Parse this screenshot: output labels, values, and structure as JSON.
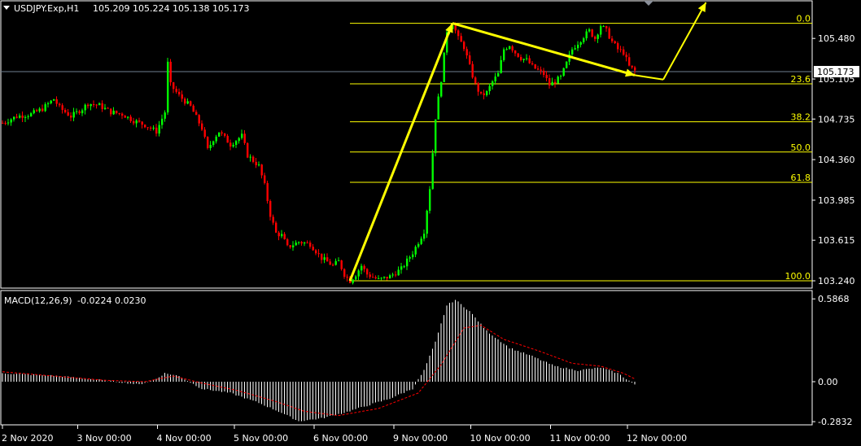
{
  "header": {
    "symbol": "USDJPY.Exp,H1",
    "ohlc": "105.209 105.224 105.138 105.173",
    "menu_icon": "triangle-down-icon"
  },
  "colors": {
    "background": "#000000",
    "bull": "#00ff00",
    "bear": "#ff0000",
    "fib": "#ffff00",
    "arrow": "#ffff00",
    "text": "#ffffff",
    "price_line": "#708090",
    "signal": "#ff0000",
    "histogram": "#ffffff",
    "border": "#ffffff"
  },
  "chart_data": [
    {
      "type": "candlestick",
      "title": "USDJPY.Exp,H1",
      "y_ticks": [
        "105.480",
        "105.105",
        "104.735",
        "104.360",
        "103.985",
        "103.615",
        "103.240"
      ],
      "y_tick_values": [
        105.48,
        105.105,
        104.735,
        104.36,
        103.985,
        103.615,
        103.24
      ],
      "ylim": [
        103.18,
        105.82
      ],
      "x_ticks": [
        "2 Nov 2020",
        "3 Nov 00:00",
        "4 Nov 00:00",
        "5 Nov 00:00",
        "6 Nov 00:00",
        "9 Nov 00:00",
        "10 Nov 00:00",
        "11 Nov 00:00",
        "12 Nov 00:00"
      ],
      "current_price": "105.173",
      "current_price_value": 105.173,
      "price_path": [
        [
          0,
          104.7
        ],
        [
          5,
          104.76
        ],
        [
          10,
          104.78
        ],
        [
          14,
          104.83
        ],
        [
          18,
          104.92
        ],
        [
          20,
          104.84
        ],
        [
          24,
          104.76
        ],
        [
          28,
          104.83
        ],
        [
          30,
          104.88
        ],
        [
          34,
          104.86
        ],
        [
          38,
          104.8
        ],
        [
          42,
          104.78
        ],
        [
          46,
          104.72
        ],
        [
          50,
          104.68
        ],
        [
          54,
          104.62
        ],
        [
          57,
          104.8
        ],
        [
          58,
          105.25
        ],
        [
          59,
          105.05
        ],
        [
          62,
          104.95
        ],
        [
          66,
          104.85
        ],
        [
          70,
          104.65
        ],
        [
          72,
          104.45
        ],
        [
          74,
          104.55
        ],
        [
          76,
          104.62
        ],
        [
          80,
          104.5
        ],
        [
          84,
          104.58
        ],
        [
          86,
          104.4
        ],
        [
          90,
          104.3
        ],
        [
          92,
          104.12
        ],
        [
          94,
          103.85
        ],
        [
          96,
          103.68
        ],
        [
          98,
          103.66
        ],
        [
          100,
          103.55
        ],
        [
          104,
          103.6
        ],
        [
          108,
          103.58
        ],
        [
          112,
          103.45
        ],
        [
          116,
          103.38
        ],
        [
          118,
          103.42
        ],
        [
          120,
          103.3
        ],
        [
          122,
          103.24
        ],
        [
          124,
          103.3
        ],
        [
          126,
          103.38
        ],
        [
          128,
          103.3
        ],
        [
          132,
          103.25
        ],
        [
          136,
          103.28
        ],
        [
          140,
          103.35
        ],
        [
          144,
          103.5
        ],
        [
          146,
          103.6
        ],
        [
          148,
          103.7
        ],
        [
          150,
          104.1
        ],
        [
          152,
          104.75
        ],
        [
          154,
          105.1
        ],
        [
          156,
          105.55
        ],
        [
          158,
          105.62
        ],
        [
          160,
          105.48
        ],
        [
          162,
          105.4
        ],
        [
          164,
          105.22
        ],
        [
          166,
          105.05
        ],
        [
          168,
          104.95
        ],
        [
          170,
          104.98
        ],
        [
          172,
          105.08
        ],
        [
          174,
          105.15
        ],
        [
          176,
          105.38
        ],
        [
          178,
          105.42
        ],
        [
          180,
          105.35
        ],
        [
          182,
          105.3
        ],
        [
          184,
          105.28
        ],
        [
          186,
          105.22
        ],
        [
          190,
          105.15
        ],
        [
          192,
          105.05
        ],
        [
          196,
          105.12
        ],
        [
          198,
          105.25
        ],
        [
          200,
          105.38
        ],
        [
          204,
          105.5
        ],
        [
          206,
          105.55
        ],
        [
          208,
          105.48
        ],
        [
          210,
          105.6
        ],
        [
          212,
          105.55
        ],
        [
          214,
          105.45
        ],
        [
          216,
          105.38
        ],
        [
          218,
          105.35
        ],
        [
          220,
          105.22
        ],
        [
          222,
          105.18
        ]
      ],
      "trade_plan": {
        "impulse_from": [
          122,
          103.24
        ],
        "impulse_to": [
          158,
          105.62
        ],
        "channel_top": [
          158,
          105.62
        ],
        "channel_end": [
          222,
          105.14
        ],
        "projection_end": [
          232,
          105.1
        ],
        "target_end": [
          247,
          106.0
        ]
      }
    },
    {
      "type": "fibonacci",
      "levels": [
        {
          "label": "0.0",
          "value": 105.62
        },
        {
          "label": "23.6",
          "value": 105.06
        },
        {
          "label": "38.2",
          "value": 104.71
        },
        {
          "label": "50.0",
          "value": 104.43
        },
        {
          "label": "61.8",
          "value": 104.15
        },
        {
          "label": "100.0",
          "value": 103.24
        }
      ]
    },
    {
      "type": "bar",
      "title": "MACD(12,26,9)",
      "values_text": "-0.0224 0.0230",
      "y_ticks": [
        "0.5868",
        "0.00",
        "-0.2832"
      ],
      "y_tick_values": [
        0.5868,
        0.0,
        -0.2832
      ],
      "ylim": [
        -0.3,
        0.64
      ],
      "series": [
        {
          "name": "MACD",
          "points": [
            [
              0,
              0.06
            ],
            [
              10,
              0.05
            ],
            [
              20,
              0.04
            ],
            [
              30,
              0.02
            ],
            [
              40,
              0.0
            ],
            [
              48,
              -0.02
            ],
            [
              54,
              0.02
            ],
            [
              57,
              0.06
            ],
            [
              62,
              0.04
            ],
            [
              70,
              -0.05
            ],
            [
              80,
              -0.08
            ],
            [
              90,
              -0.15
            ],
            [
              98,
              -0.22
            ],
            [
              104,
              -0.28
            ],
            [
              112,
              -0.26
            ],
            [
              120,
              -0.22
            ],
            [
              128,
              -0.17
            ],
            [
              136,
              -0.12
            ],
            [
              144,
              -0.05
            ],
            [
              148,
              0.08
            ],
            [
              152,
              0.28
            ],
            [
              156,
              0.54
            ],
            [
              159,
              0.58
            ],
            [
              164,
              0.5
            ],
            [
              170,
              0.36
            ],
            [
              178,
              0.24
            ],
            [
              186,
              0.18
            ],
            [
              194,
              0.11
            ],
            [
              202,
              0.08
            ],
            [
              210,
              0.1
            ],
            [
              216,
              0.06
            ],
            [
              222,
              -0.02
            ]
          ]
        },
        {
          "name": "Signal",
          "points": [
            [
              0,
              0.07
            ],
            [
              12,
              0.05
            ],
            [
              24,
              0.03
            ],
            [
              36,
              0.01
            ],
            [
              50,
              0.0
            ],
            [
              60,
              0.04
            ],
            [
              70,
              -0.01
            ],
            [
              82,
              -0.06
            ],
            [
              96,
              -0.14
            ],
            [
              106,
              -0.21
            ],
            [
              118,
              -0.24
            ],
            [
              132,
              -0.19
            ],
            [
              146,
              -0.08
            ],
            [
              154,
              0.12
            ],
            [
              162,
              0.38
            ],
            [
              168,
              0.4
            ],
            [
              176,
              0.3
            ],
            [
              188,
              0.22
            ],
            [
              200,
              0.13
            ],
            [
              210,
              0.11
            ],
            [
              218,
              0.06
            ],
            [
              222,
              0.02
            ]
          ]
        }
      ]
    }
  ]
}
